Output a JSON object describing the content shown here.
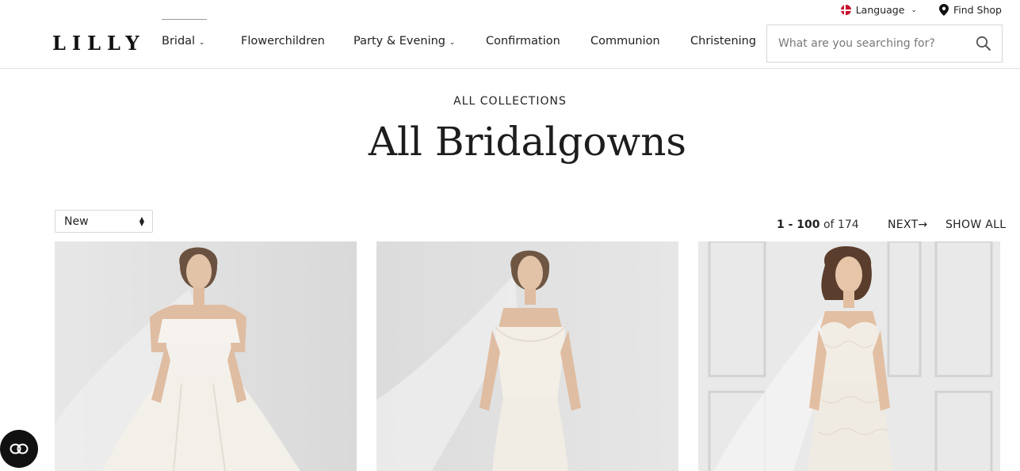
{
  "utility": {
    "language_label": "Language",
    "findshop_label": "Find Shop"
  },
  "header": {
    "logo": "LILLY",
    "nav": [
      {
        "label": "Bridal",
        "has_dropdown": true
      },
      {
        "label": "Flowerchildren",
        "has_dropdown": false
      },
      {
        "label": "Party & Evening",
        "has_dropdown": true
      },
      {
        "label": "Confirmation",
        "has_dropdown": false
      },
      {
        "label": "Communion",
        "has_dropdown": false
      },
      {
        "label": "Christening",
        "has_dropdown": false
      }
    ],
    "search_placeholder": "What are you searching for?"
  },
  "page": {
    "eyebrow": "ALL COLLECTIONS",
    "title": "All Bridalgowns"
  },
  "toolbar": {
    "sort_value": "New",
    "range": "1 - 100",
    "of_label": "of 174",
    "next_label": "NEXT",
    "show_all_label": "SHOW ALL"
  },
  "products": [
    {
      "image": "off-shoulder-bridal-gown-photo"
    },
    {
      "image": "cowl-neck-slip-bridal-gown-photo"
    },
    {
      "image": "lace-sweetheart-bridal-gown-photo"
    }
  ],
  "colors": {
    "text": "#222222",
    "border": "#d6d6d6",
    "chat_bg": "#111111"
  }
}
